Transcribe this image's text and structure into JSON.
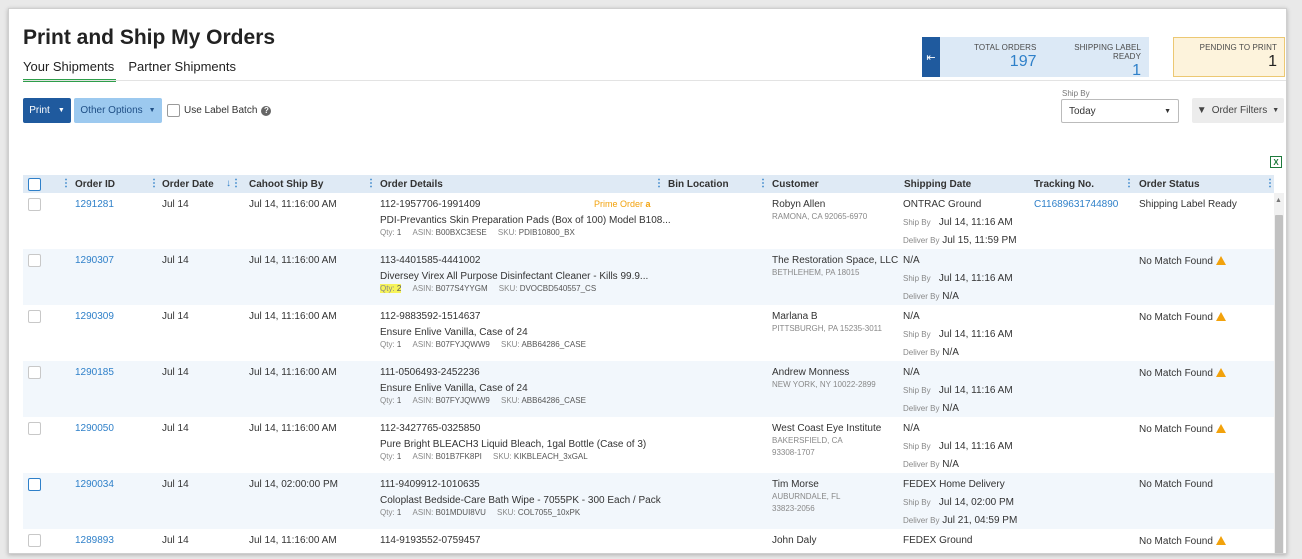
{
  "page": {
    "title": "Print and Ship My Orders"
  },
  "tabs": [
    {
      "label": "Your Shipments",
      "active": true
    },
    {
      "label": "Partner Shipments",
      "active": false
    }
  ],
  "stats": {
    "total_orders_label": "TOTAL ORDERS",
    "total_orders_value": "197",
    "label_ready_label": "SHIPPING LABEL READY",
    "label_ready_value": "1",
    "pending_label": "PENDING TO PRINT",
    "pending_value": "1"
  },
  "toolbar": {
    "print_label": "Print",
    "other_options_label": "Other Options",
    "use_label_batch_label": "Use Label Batch",
    "ship_by_label": "Ship By",
    "ship_by_value": "Today",
    "order_filters_label": "Order Filters"
  },
  "columns": {
    "order_id": "Order ID",
    "order_date": "Order Date",
    "cahoot_ship_by": "Cahoot Ship By",
    "order_details": "Order Details",
    "bin_location": "Bin Location",
    "customer": "Customer",
    "shipping_date": "Shipping Date",
    "tracking_no": "Tracking No.",
    "order_status": "Order Status"
  },
  "labels": {
    "qty": "Qty:",
    "asin": "ASIN:",
    "sku": "SKU:",
    "ship_by": "Ship By",
    "deliver_by": "Deliver By",
    "prime_order": "Prime Order",
    "prime_mark": "a"
  },
  "rows": [
    {
      "id": "1291281",
      "date": "Jul 14",
      "ship_by": "Jul 14, 11:16:00 AM",
      "order_no": "112-1957706-1991409",
      "product": "PDI-Prevantics Skin Preparation Pads (Box of 100) Model B108...",
      "qty": "1",
      "asin": "B00BXC3ESE",
      "sku": "PDIB10800_BX",
      "customer": "Robyn Allen",
      "addr1": "RAMONA, CA 92065-6970",
      "addr2": "",
      "ship_method": "ONTRAC Ground",
      "ship_by_date": "Jul 14, 11:16 AM",
      "deliver_by": "Jul 15, 11:59 PM",
      "tracking": "C11689631744890",
      "status": "Shipping Label Ready"
    },
    {
      "id": "1290307",
      "date": "Jul 14",
      "ship_by": "Jul 14, 11:16:00 AM",
      "order_no": "113-4401585-4441002",
      "product": "Diversey Virex All Purpose Disinfectant Cleaner - Kills 99.9...",
      "qty": "2",
      "asin": "B077S4YYGM",
      "sku": "DVOCBD540557_CS",
      "customer": "The Restoration Space, LLC",
      "addr1": "BETHLEHEM, PA 18015",
      "addr2": "",
      "ship_method": "N/A",
      "ship_by_date": "Jul 14, 11:16 AM",
      "deliver_by": "N/A",
      "tracking": "",
      "status": "No Match Found"
    },
    {
      "id": "1290309",
      "date": "Jul 14",
      "ship_by": "Jul 14, 11:16:00 AM",
      "order_no": "112-9883592-1514637",
      "product": "Ensure Enlive Vanilla, Case of 24",
      "qty": "1",
      "asin": "B07FYJQWW9",
      "sku": "ABB64286_CASE",
      "customer": "Marlana B",
      "addr1": "PITTSBURGH, PA 15235-3011",
      "addr2": "",
      "ship_method": "N/A",
      "ship_by_date": "Jul 14, 11:16 AM",
      "deliver_by": "N/A",
      "tracking": "",
      "status": "No Match Found"
    },
    {
      "id": "1290185",
      "date": "Jul 14",
      "ship_by": "Jul 14, 11:16:00 AM",
      "order_no": "111-0506493-2452236",
      "product": "Ensure Enlive Vanilla, Case of 24",
      "qty": "1",
      "asin": "B07FYJQWW9",
      "sku": "ABB64286_CASE",
      "customer": "Andrew Monness",
      "addr1": "NEW YORK, NY 10022-2899",
      "addr2": "",
      "ship_method": "N/A",
      "ship_by_date": "Jul 14, 11:16 AM",
      "deliver_by": "N/A",
      "tracking": "",
      "status": "No Match Found"
    },
    {
      "id": "1290050",
      "date": "Jul 14",
      "ship_by": "Jul 14, 11:16:00 AM",
      "order_no": "112-3427765-0325850",
      "product": "Pure Bright BLEACH3 Liquid Bleach, 1gal Bottle (Case of 3)",
      "qty": "1",
      "asin": "B01B7FK8PI",
      "sku": "KIKBLEACH_3xGAL",
      "customer": "West Coast Eye Institute",
      "addr1": "BAKERSFIELD, CA",
      "addr2": "93308-1707",
      "ship_method": "N/A",
      "ship_by_date": "Jul 14, 11:16 AM",
      "deliver_by": "N/A",
      "tracking": "",
      "status": "No Match Found"
    },
    {
      "id": "1290034",
      "date": "Jul 14",
      "ship_by": "Jul 14, 02:00:00 PM",
      "order_no": "111-9409912-1010635",
      "product": "Coloplast Bedside-Care Bath Wipe - 7055PK - 300 Each / Pack",
      "qty": "1",
      "asin": "B01MDUI8VU",
      "sku": "COL7055_10xPK",
      "customer": "Tim Morse",
      "addr1": "AUBURNDALE, FL",
      "addr2": "33823-2056",
      "ship_method": "FEDEX Home Delivery",
      "ship_by_date": "Jul 14, 02:00 PM",
      "deliver_by": "Jul 21, 04:59 PM",
      "tracking": "",
      "status": "No Match Found"
    },
    {
      "id": "1289893",
      "date": "Jul 14",
      "ship_by": "Jul 14, 11:16:00 AM",
      "order_no": "114-9193552-0759457",
      "product": "",
      "qty": "",
      "asin": "",
      "sku": "",
      "customer": "John Daly",
      "addr1": "",
      "addr2": "",
      "ship_method": "FEDEX Ground",
      "ship_by_date": "",
      "deliver_by": "",
      "tracking": "",
      "status": "No Match Found"
    }
  ]
}
